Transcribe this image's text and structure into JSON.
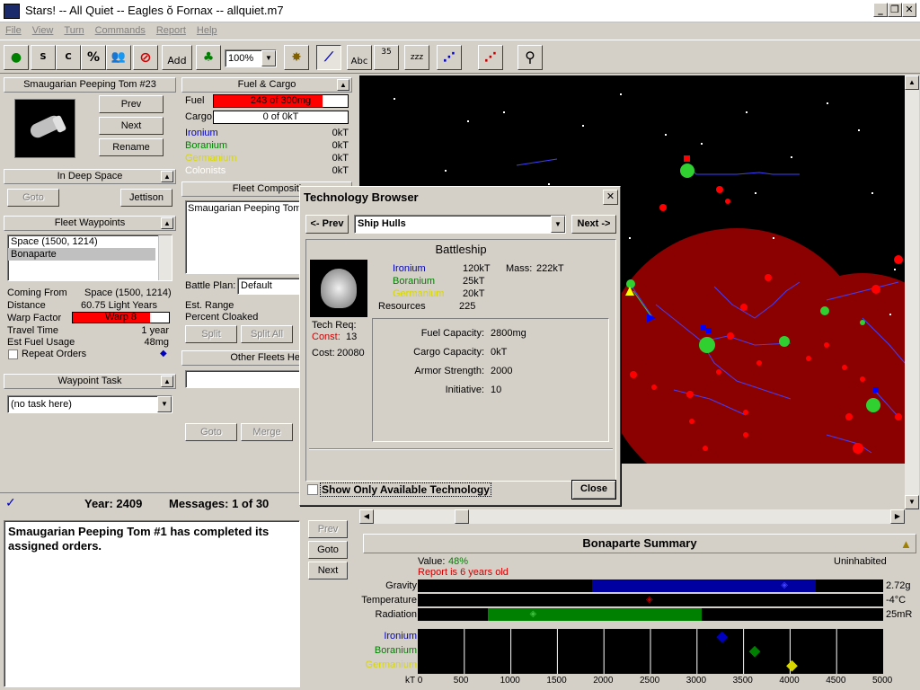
{
  "window": {
    "title": "Stars! -- All Quiet -- Eagles ŏ Fornax -- allquiet.m7",
    "min": "_",
    "restore": "❐",
    "close": "✕"
  },
  "menu": [
    "File",
    "View",
    "Turn",
    "Commands",
    "Report",
    "Help"
  ],
  "toolbar": {
    "percent_glyph": "%",
    "add_label": "Add",
    "zoom": "100%",
    "abc": "Abc",
    "num35": "35",
    "zzz": "zzz"
  },
  "ship": {
    "header": "Smaugarian Peeping Tom #23",
    "prev": "Prev",
    "next": "Next",
    "rename": "Rename"
  },
  "fuel_cargo": {
    "header": "Fuel & Cargo",
    "fuel_label": "Fuel",
    "fuel_value": "243 of 300mg",
    "fuel_pct": 81,
    "cargo_label": "Cargo",
    "cargo_value": "0 of 0kT",
    "rows": [
      {
        "name": "Ironium",
        "value": "0kT",
        "color": "#0000c0"
      },
      {
        "name": "Boranium",
        "value": "0kT",
        "color": "#008000"
      },
      {
        "name": "Germanium",
        "value": "0kT",
        "color": "#d8d800"
      },
      {
        "name": "Colonists",
        "value": "0kT",
        "color": "#ffffff"
      }
    ]
  },
  "deep_space": {
    "header": "In Deep Space",
    "goto": "Goto",
    "jettison": "Jettison"
  },
  "fleet_comp": {
    "header": "Fleet Compositi",
    "item": "Smaugarian Peeping Tom",
    "battle_label": "Battle Plan:",
    "battle_value": "Default",
    "range_label": "Est. Range",
    "cloak_label": "Percent Cloaked",
    "split": "Split",
    "split_all": "Split All"
  },
  "waypoints": {
    "header": "Fleet Waypoints",
    "items": [
      "Space (1500, 1214)",
      "Bonaparte"
    ],
    "coming_from_label": "Coming From",
    "coming_from": "Space (1500, 1214)",
    "distance_label": "Distance",
    "distance": "60.75  Light Years",
    "warp_label": "Warp Factor",
    "warp": "Warp 8",
    "warp_pct": 80,
    "travel_label": "Travel Time",
    "travel": "1 year",
    "fuel_label": "Est Fuel Usage",
    "fuel": "48mg",
    "repeat": "Repeat Orders"
  },
  "other_fleets": {
    "header": "Other Fleets Her",
    "goto": "Goto",
    "merge": "Merge"
  },
  "waypoint_task": {
    "header": "Waypoint Task",
    "value": "(no task here)"
  },
  "messages": {
    "year": "Year: 2409",
    "count": "Messages: 1 of 30",
    "text": "Smaugarian Peeping Tom #1 has completed its assigned orders.",
    "prev": "Prev",
    "goto": "Goto",
    "next": "Next"
  },
  "tech": {
    "title": "Technology Browser",
    "close_x": "✕",
    "prev": "<- Prev",
    "next": "Next ->",
    "category": "Ship Hulls",
    "item": "Battleship",
    "minerals": [
      {
        "name": "Ironium",
        "value": "120kT",
        "color": "#0000c0"
      },
      {
        "name": "Boranium",
        "value": "25kT",
        "color": "#008000"
      },
      {
        "name": "Germanium",
        "value": "20kT",
        "color": "#d8d800"
      },
      {
        "name": "Resources",
        "value": "225",
        "color": "#000000"
      }
    ],
    "mass_label": "Mass:",
    "mass": "222kT",
    "techreq_label": "Tech Req:",
    "const_label": "Const:",
    "const_value": "13",
    "cost_label": "Cost:",
    "cost": "20080",
    "stats": [
      {
        "label": "Fuel Capacity:",
        "value": "2800mg"
      },
      {
        "label": "Cargo Capacity:",
        "value": "0kT"
      },
      {
        "label": "Armor Strength:",
        "value": "2000"
      },
      {
        "label": "Initiative:",
        "value": "10"
      }
    ],
    "show_only": "Show Only Available Technology",
    "close": "Close"
  },
  "summary": {
    "title": "Bonaparte Summary",
    "value_label": "Value:",
    "value": "48%",
    "report": "Report is 6 years old",
    "status": "Uninhabited",
    "env": [
      {
        "name": "Gravity",
        "value": "2.72g",
        "range": [
          0.375,
          0.855
        ],
        "marker": 0.79,
        "color": "#0000a0",
        "mcolor": "#4040ff"
      },
      {
        "name": "Temperature",
        "value": "-4°C",
        "range": [
          0,
          0
        ],
        "marker": 0.5,
        "color": "#000000",
        "mcolor": "#c00000"
      },
      {
        "name": "Radiation",
        "value": "25mR",
        "range": [
          0.15,
          0.61
        ],
        "marker": 0.25,
        "color": "#008000",
        "mcolor": "#40c040"
      }
    ],
    "minerals": [
      {
        "name": "Ironium",
        "color": "#0000c0",
        "value": 3270
      },
      {
        "name": "Boranium",
        "color": "#008000",
        "value": 3620
      },
      {
        "name": "Germanium",
        "color": "#d8d800",
        "value": 4020
      }
    ],
    "axis_ticks": [
      "kT 0",
      "500",
      "1000",
      "1500",
      "2000",
      "2500",
      "3000",
      "3500",
      "4000",
      "4500",
      "5000"
    ]
  }
}
